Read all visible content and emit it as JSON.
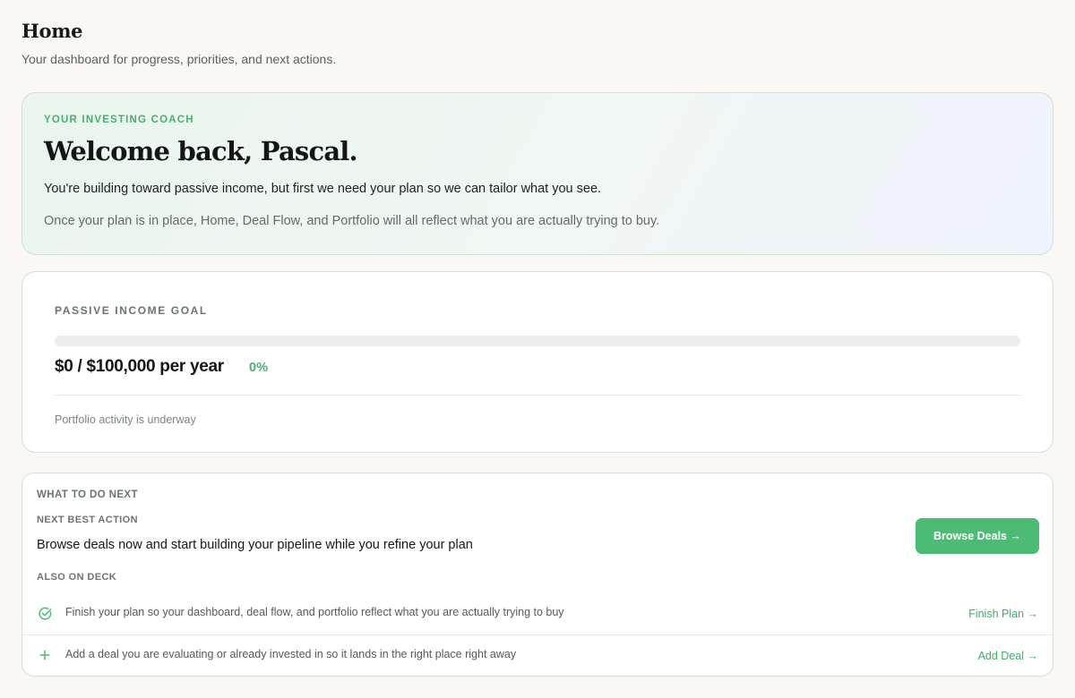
{
  "header": {
    "title": "Home",
    "subtitle": "Your dashboard for progress, priorities, and next actions."
  },
  "coach": {
    "eyebrow": "YOUR INVESTING COACH",
    "heading": "Welcome back, Pascal.",
    "lead": "You're building toward passive income, but first we need your plan so we can tailor what you see.",
    "note": "Once your plan is in place, Home, Deal Flow, and Portfolio will all reflect what you are actually trying to buy."
  },
  "goal": {
    "eyebrow": "PASSIVE INCOME GOAL",
    "amount": "$0 / $100,000 per year",
    "percent_label": "0%",
    "progress_fraction": 0,
    "status": "Portfolio activity is underway",
    "accent_color": "#4cbc74"
  },
  "next": {
    "eyebrow": "WHAT TO DO NEXT",
    "best_action_eyebrow": "NEXT BEST ACTION",
    "best_action_text": "Browse deals now and start building your pipeline while you refine your plan",
    "browse_button_label": "Browse Deals →",
    "deck_eyebrow": "ALSO ON DECK",
    "deck_items": [
      {
        "icon": "check-circle-icon",
        "text": "Finish your plan so your dashboard, deal flow, and portfolio reflect what you are actually trying to buy",
        "link_label": "Finish Plan →"
      },
      {
        "icon": "plus-icon",
        "text": "Add a deal you are evaluating or already invested in so it lands in the right place right away",
        "link_label": "Add Deal →"
      }
    ]
  }
}
